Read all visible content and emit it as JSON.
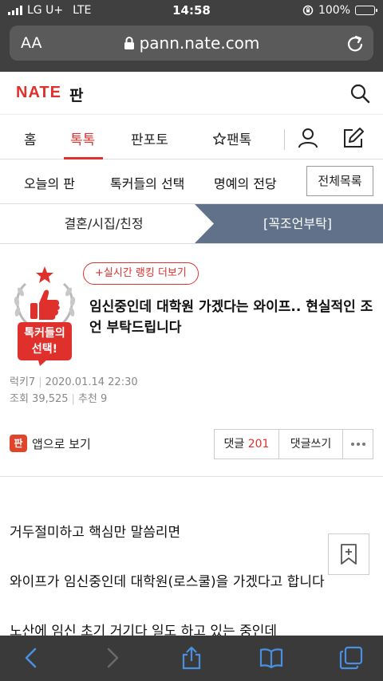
{
  "status": {
    "carrier": "LG U+",
    "network": "LTE",
    "time": "14:58",
    "battery": "100%"
  },
  "browser": {
    "text_size_label": "AA",
    "url": "pann.nate.com"
  },
  "header": {
    "logo": "NATE",
    "logo_sub": "판"
  },
  "nav": {
    "tabs": [
      "홈",
      "톡톡",
      "판포토",
      "팬톡"
    ],
    "active": "톡톡"
  },
  "subnav": {
    "items": [
      "오늘의 판",
      "톡커들의 선택",
      "명예의 전당"
    ],
    "all_button": "전체목록"
  },
  "categories": {
    "left": "결혼/시집/친정",
    "right": "[꼭조언부탁]"
  },
  "article": {
    "badge_text_line1": "톡커들의",
    "badge_text_line2": "선택!",
    "ranking_button": "+실시간 랭킹 더보기",
    "title": "임신중인데 대학원 가겠다는 와이프.. 현실적인 조언 부탁드립니다",
    "author": "럭키7",
    "date": "2020.01.14 22:30",
    "views": "조회 39,525",
    "recommend": "추천 9",
    "app_view_label": "앱으로 보기",
    "app_icon_text": "판",
    "comment_label": "댓글",
    "comment_count": "201",
    "write_comment_label": "댓글쓰기",
    "body": [
      "거두절미하고 핵심만 말씀리면",
      "와이프가 임신중인데 대학원(로스쿨)을 가겠다고 합니다",
      "노산에 임신 초기 거기다 일도 하고 있는 중인데"
    ]
  },
  "colors": {
    "accent": "#e0302c",
    "category_active_bg": "#607189",
    "chrome_bg": "#404040"
  }
}
